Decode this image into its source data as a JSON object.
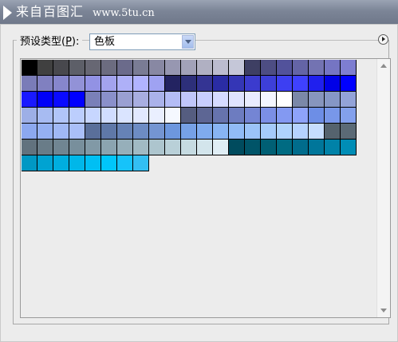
{
  "header": {
    "title": "来自百图汇",
    "url": "www.5tu.cn"
  },
  "preset": {
    "label_text": "预设类型(",
    "label_key": "P",
    "label_end": "):",
    "value": "色板"
  },
  "swatches": [
    "#000000",
    "#404040",
    "#48484d",
    "#5d5f68",
    "#676773",
    "#6c6c80",
    "#6b6b8b",
    "#7a7c94",
    "#8888a3",
    "#9797b1",
    "#a2a2b8",
    "#b0b0c2",
    "#bcbccf",
    "#c5c7d8",
    "#3e3f63",
    "#4d4d83",
    "#52529b",
    "#6464a6",
    "#7373b2",
    "#7575c3",
    "#7e7ed1",
    "#7a7cb8",
    "#8080c0",
    "#8686cc",
    "#9292d7",
    "#9292e4",
    "#a3a3ee",
    "#aeb0f8",
    "#b1b3ff",
    "#9fa2f2",
    "#232361",
    "#2d2f7a",
    "#343493",
    "#2a2ca4",
    "#3436b6",
    "#3b3bce",
    "#3d3fd9",
    "#3d3ff2",
    "#3f41ff",
    "#2020ee",
    "#0000e7",
    "#0000ff",
    "#1919ff",
    "#0000f9",
    "#0a0aff",
    "#0000ff",
    "#7a80b8",
    "#8a90ca",
    "#9aa0d2",
    "#a8aee0",
    "#aab2ea",
    "#b4bcf5",
    "#c0c6fa",
    "#c8cefe",
    "#d6dbff",
    "#e0e4ff",
    "#e9ecff",
    "#f4f6ff",
    "#ffffff",
    "#7b88a8",
    "#8795bd",
    "#8697c6",
    "#93a3d8",
    "#9dafe6",
    "#a7bbf2",
    "#b1c5f9",
    "#bccefd",
    "#c7d6ff",
    "#d1ddff",
    "#dae4ff",
    "#e2e9ff",
    "#eaefff",
    "#f5f8ff",
    "#555d80",
    "#5d6694",
    "#6673ad",
    "#6d7cc0",
    "#7485d4",
    "#7b8fe6",
    "#8399f2",
    "#8ea3fa",
    "#6d8ee6",
    "#7897e9",
    "#83a0ec",
    "#8ca8ef",
    "#95b0f2",
    "#a0b8f5",
    "#aabff8",
    "#5a6f9a",
    "#5f78a8",
    "#6682b6",
    "#6d8cc4",
    "#7495d2",
    "#6d97de",
    "#76a1e6",
    "#7fabee",
    "#88b4f3",
    "#91bbf6",
    "#9bc3f8",
    "#a5cbfa",
    "#afd3fc",
    "#b5d3ff",
    "#c6ddfe",
    "#55636e",
    "#5b6a76",
    "#62727e",
    "#697c88",
    "#708592",
    "#788f9c",
    "#8199a6",
    "#8ba4b0",
    "#96afba",
    "#a1bac4",
    "#adc5ce",
    "#b9d0d8",
    "#c6dbe2",
    "#d3e5ec",
    "#e0eef5",
    "#004b5e",
    "#005468",
    "#005f74",
    "#006b82",
    "#006c8c",
    "#00769a",
    "#0082a8",
    "#008db6",
    "#0098c4",
    "#00a3d2",
    "#00aedf",
    "#00b7e9",
    "#00bff3",
    "#00c6fa",
    "#16c3fa",
    "#33bff3"
  ],
  "icons": {
    "title_play": "play-icon",
    "dropdown": "chevron-down-icon",
    "menu": "panel-menu-icon",
    "scroll_up": "scroll-up-arrow-icon",
    "scroll_down": "scroll-down-arrow-icon"
  }
}
